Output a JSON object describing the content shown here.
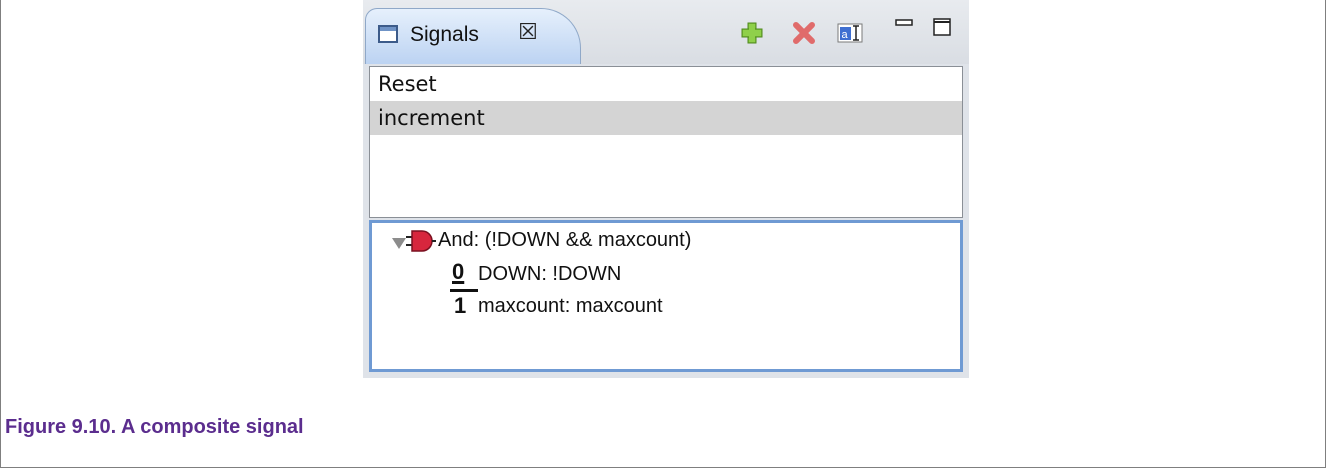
{
  "view": {
    "tab_title": "Signals",
    "tab_close_glyph": "☒",
    "toolbar": {
      "add_icon": "add-signal-icon",
      "remove_icon": "remove-signal-icon",
      "rename_icon": "rename-signal-icon",
      "minimize_icon": "minimize-icon",
      "maximize_icon": "maximize-icon"
    }
  },
  "signals": {
    "items": [
      {
        "label": "Reset",
        "selected": false
      },
      {
        "label": "increment",
        "selected": true
      }
    ]
  },
  "tree": {
    "root": {
      "icon": "and-gate-icon",
      "label": "And: (!DOWN && maxcount)"
    },
    "children": [
      {
        "icon": "zero-signal-icon",
        "glyph": "0",
        "label": "DOWN: !DOWN"
      },
      {
        "icon": "one-signal-icon",
        "glyph": "1",
        "label": "maxcount: maxcount"
      }
    ]
  },
  "caption": "Figure 9.10. A composite signal",
  "colors": {
    "tab_gradient_top": "#e6f0fc",
    "selection": "#d4d4d4",
    "tree_border": "#6f9ad3",
    "caption": "#5b2d8e",
    "and_gate": "#d7263d"
  }
}
